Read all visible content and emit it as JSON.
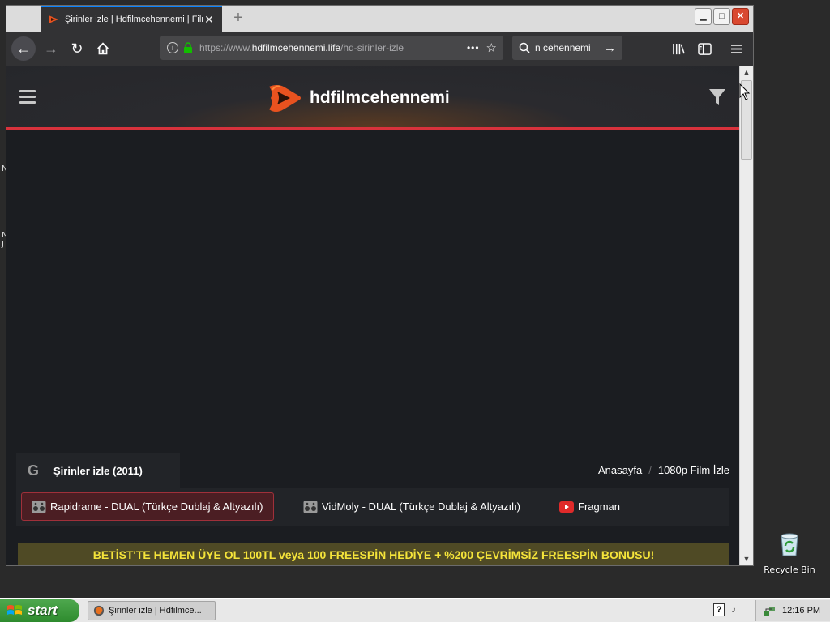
{
  "desktop": {
    "side_glyphs": [
      "N",
      "N",
      "J"
    ],
    "recycle_bin_label": "Recycle Bin"
  },
  "browser": {
    "tab_title": "Şirinler izle | Hdfilmcehennemi | Film",
    "new_tab_symbol": "+",
    "address": {
      "prefix": "https://www.",
      "domain": "hdfilmcehennemi.life",
      "path": "/hd-sirinler-izle",
      "dots": "•••"
    },
    "search_text": "n cehennemi",
    "window_controls": {
      "minimize": "▁",
      "maximize": "□",
      "close": "✕"
    }
  },
  "site": {
    "logo_text": "hdfilmcehennemi",
    "movie_title": "Şirinler izle (2011)",
    "breadcrumb": {
      "home": "Anasayfa",
      "separator": "/",
      "current": "1080p Film İzle"
    },
    "sources": [
      {
        "label": "Rapidrame - DUAL (Türkçe Dublaj & Altyazılı)",
        "active": true
      },
      {
        "label": "VidMoly - DUAL (Türkçe Dublaj & Altyazılı)",
        "active": false
      },
      {
        "label": "Fragman",
        "active": false
      }
    ],
    "banner": "BETİST'TE HEMEN ÜYE OL 100TL veya 100 FREESPİN HEDİYE + %200 ÇEVRİMSİZ FREESPİN BONUSU!"
  },
  "taskbar": {
    "start_label": "start",
    "task_item": "Şirinler izle | Hdfilmce...",
    "clock": "12:16 PM",
    "help": "?"
  },
  "colors": {
    "accent_red": "#d8323c",
    "banner_text": "#f5e43a",
    "firefox_blue": "#0a84ff"
  }
}
